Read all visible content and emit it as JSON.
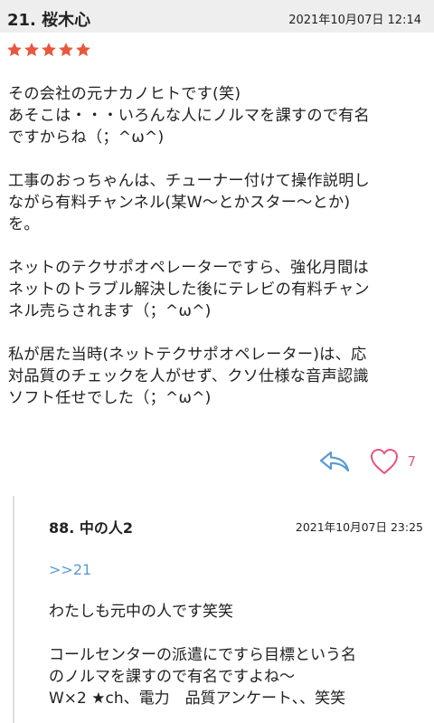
{
  "review": {
    "number_label": "21.  桜木心",
    "date": "2021年10月07日 12:14",
    "rating": 5,
    "rating_max": 5,
    "star_color": "#e8583f",
    "body": "その会社の元ナカノヒトです(笑)\nあそこは・・・いろんな人にノルマを課すので有名\nですからね（；^ω^)\n\n工事のおっちゃんは、チューナー付けて操作説明し\nながら有料チャンネル(某W〜とかスター〜とか)\nを。\n\nネットのテクサポオペレーターですら、強化月間は\nネットのトラブル解決した後にテレビの有料チャン\nネル売らされます（；^ω^)\n\n私が居た当時(ネットテクサポオペレーター)は、応\n対品質のチェックを人がせず、クソ仕様な音声認識\nソフト任せでした（；^ω^)",
    "like_count": "7",
    "reply_icon": "reply-arrow-icon",
    "like_icon": "heart-outline-icon"
  },
  "reply": {
    "number_label": "88.  中の人2",
    "date": "2021年10月07日 23:25",
    "anchor": ">>21",
    "body": "わたしも元中の人です笑笑\n\nコールセンターの派遣にですら目標という名\nのノルマを課すので有名ですよね〜\nW×2 ★ch、電力　品質アンケート、、笑笑"
  },
  "colors": {
    "header_bg": "#eeeeee",
    "anchor": "#5a9bd5",
    "reply_icon": "#5a9bd5",
    "like_icon": "#e75480"
  }
}
